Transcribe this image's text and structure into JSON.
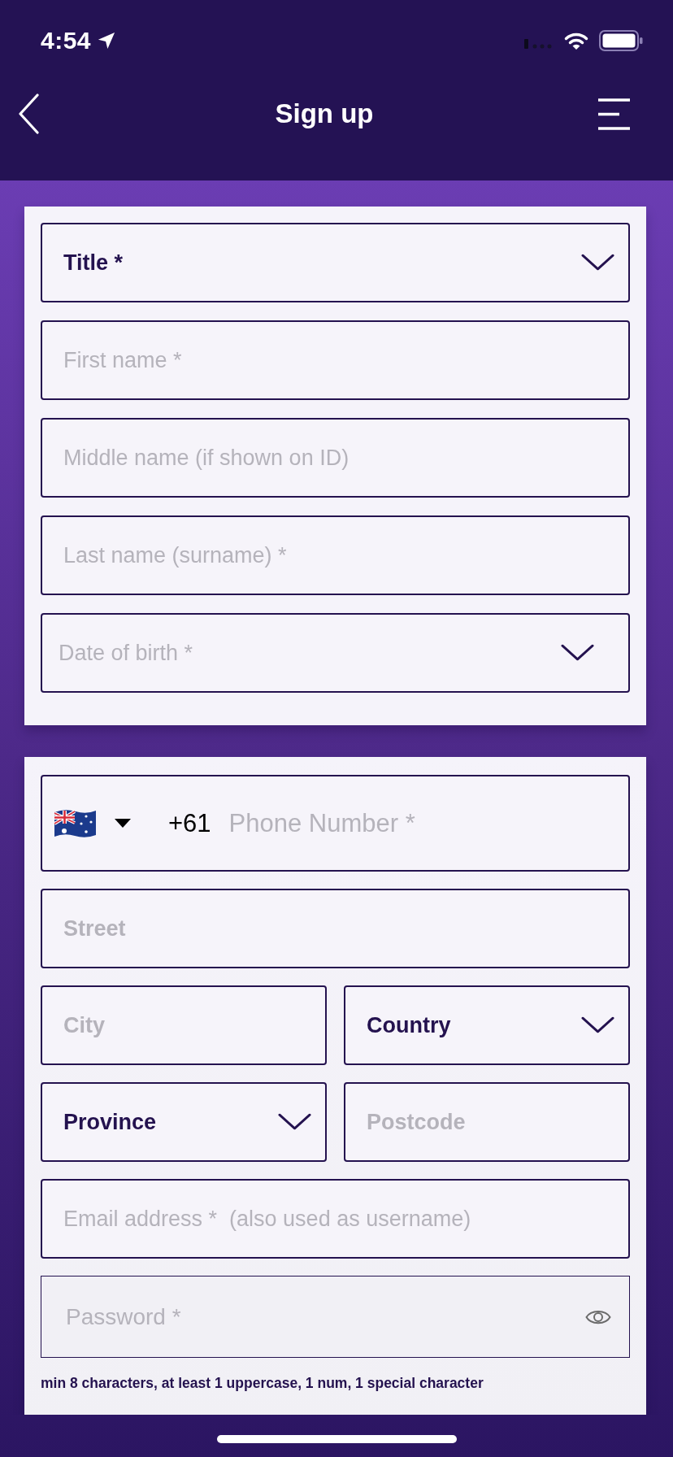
{
  "status_bar": {
    "time": "4:54"
  },
  "header": {
    "title": "Sign up"
  },
  "cards": [
    {
      "rows": [
        {
          "fields": [
            {
              "kind": "select",
              "value": "Title *"
            }
          ]
        },
        {
          "fields": [
            {
              "kind": "text",
              "placeholder": "First name *",
              "bold": false
            }
          ]
        },
        {
          "fields": [
            {
              "kind": "text",
              "placeholder": "Middle name (if shown on ID)",
              "bold": false
            }
          ]
        },
        {
          "fields": [
            {
              "kind": "text",
              "placeholder": "Last name (surname) *",
              "bold": false
            }
          ]
        },
        {
          "fields": [
            {
              "kind": "date",
              "placeholder": "Date of birth *"
            }
          ]
        }
      ]
    },
    {
      "rows": [
        {
          "fields": [
            {
              "kind": "phone",
              "dial_code": "+61",
              "placeholder": "Phone Number *"
            }
          ]
        },
        {
          "fields": [
            {
              "kind": "text",
              "placeholder": "Street",
              "bold": true
            }
          ]
        },
        {
          "fields": [
            {
              "kind": "text",
              "placeholder": "City",
              "bold": true
            },
            {
              "kind": "select",
              "value": "Country"
            }
          ]
        },
        {
          "fields": [
            {
              "kind": "select",
              "value": "Province"
            },
            {
              "kind": "text",
              "placeholder": "Postcode",
              "bold": true
            }
          ]
        },
        {
          "fields": [
            {
              "kind": "text",
              "placeholder": "Email address *  (also used as username)",
              "bold": false
            }
          ]
        },
        {
          "fields": [
            {
              "kind": "password",
              "placeholder": "Password *"
            }
          ]
        }
      ],
      "note": "min 8 characters, at least 1 uppercase, 1 num, 1 special character"
    }
  ]
}
